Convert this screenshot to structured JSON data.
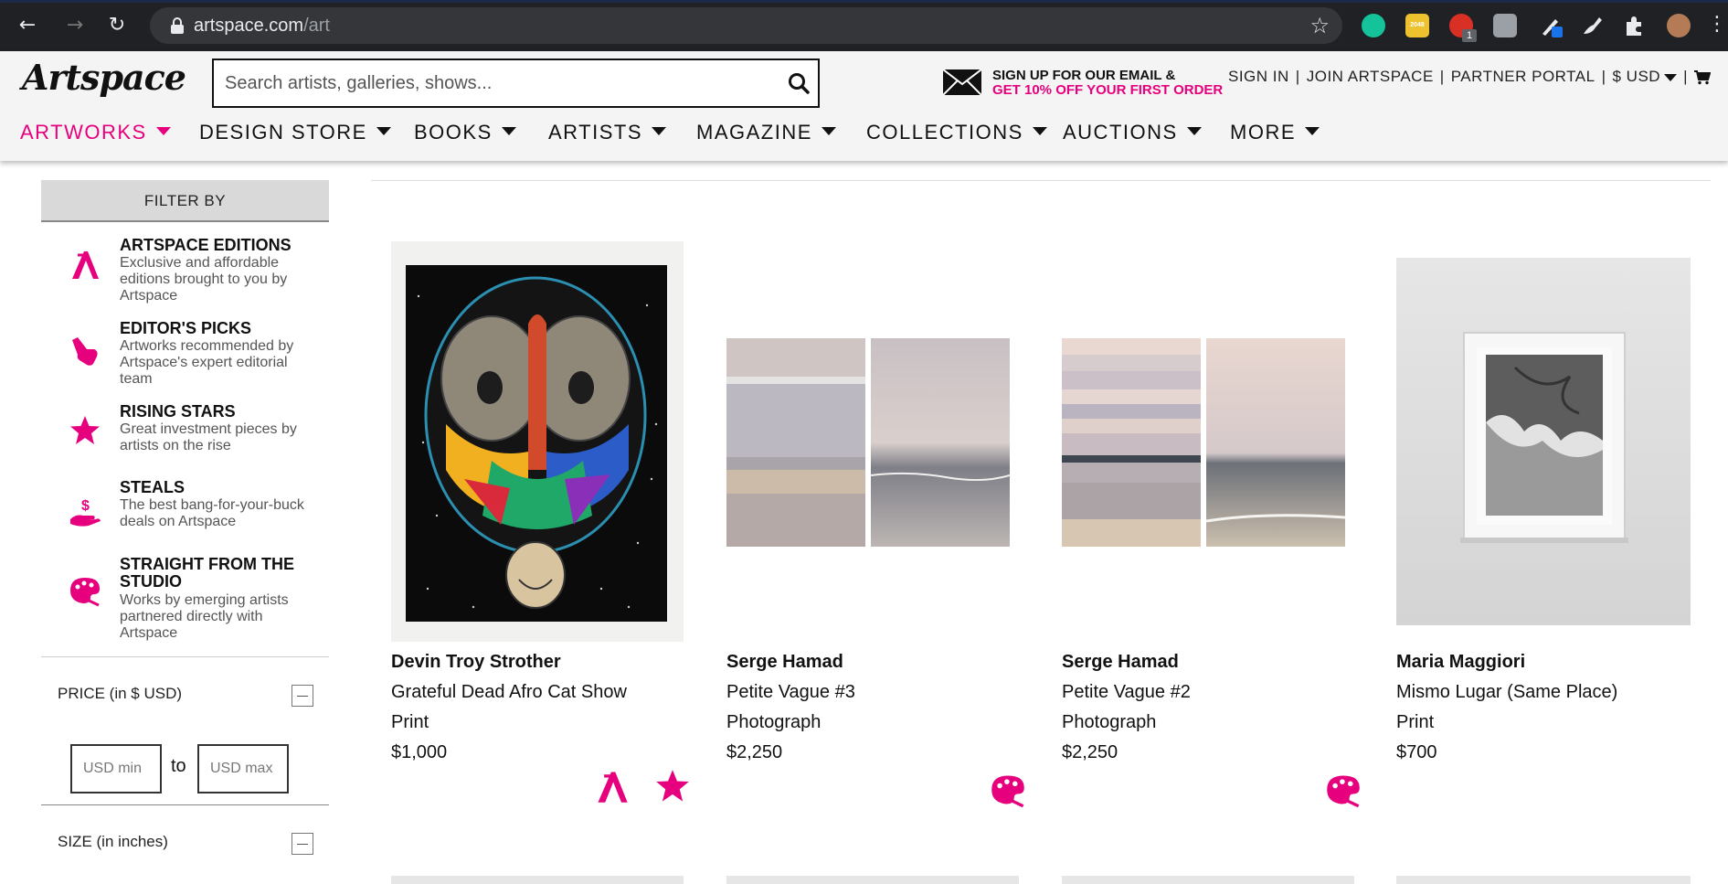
{
  "browser": {
    "url_host": "artspace.com",
    "url_path": "/art",
    "extension_badge": "1",
    "extension_2048": "2048"
  },
  "header": {
    "logo": "Artspace",
    "search_placeholder": "Search artists, galleries, shows...",
    "promo_line1": "SIGN UP FOR OUR EMAIL &",
    "promo_line2": "GET 10% OFF YOUR FIRST ORDER",
    "sign_in": "SIGN IN",
    "join": "JOIN ARTSPACE",
    "partner_portal": "PARTNER PORTAL",
    "currency": "$ USD",
    "separator": "|"
  },
  "nav": [
    {
      "label": "ARTWORKS",
      "active": true
    },
    {
      "label": "DESIGN STORE",
      "active": false
    },
    {
      "label": "BOOKS",
      "active": false
    },
    {
      "label": "ARTISTS",
      "active": false
    },
    {
      "label": "MAGAZINE",
      "active": false
    },
    {
      "label": "COLLECTIONS",
      "active": false
    },
    {
      "label": "AUCTIONS",
      "active": false
    },
    {
      "label": "MORE",
      "active": false
    }
  ],
  "sidebar": {
    "filter_by": "FILTER BY",
    "categories": [
      {
        "title": "ARTSPACE EDITIONS",
        "desc": "Exclusive and affordable editions brought to you by Artspace",
        "icon": "artspace-editions-icon"
      },
      {
        "title": "EDITOR'S PICKS",
        "desc": "Artworks recommended by Artspace's expert editorial team",
        "icon": "pointing-hand-icon"
      },
      {
        "title": "RISING STARS",
        "desc": "Great investment pieces by artists on the rise",
        "icon": "star-icon"
      },
      {
        "title": "STEALS",
        "desc": "The best bang-for-your-buck deals on Artspace",
        "icon": "hand-dollar-icon"
      },
      {
        "title": "STRAIGHT FROM THE STUDIO",
        "desc": "Works by emerging artists partnered directly with Artspace",
        "icon": "palette-icon"
      }
    ],
    "price_title": "PRICE (in $ USD)",
    "price_min_placeholder": "USD min",
    "price_to": "to",
    "price_max_placeholder": "USD max",
    "size_title": "SIZE (in inches)"
  },
  "products": [
    {
      "artist": "Devin Troy Strother",
      "title": "Grateful Dead Afro Cat Show",
      "medium": "Print",
      "price": "$1,000",
      "badges": [
        "artspace-editions-icon",
        "star-icon"
      ]
    },
    {
      "artist": "Serge Hamad",
      "title": "Petite Vague #3",
      "medium": "Photograph",
      "price": "$2,250",
      "badges": [
        "palette-icon"
      ]
    },
    {
      "artist": "Serge Hamad",
      "title": "Petite Vague #2",
      "medium": "Photograph",
      "price": "$2,250",
      "badges": [
        "palette-icon"
      ]
    },
    {
      "artist": "Maria Maggiori",
      "title": "Mismo Lugar (Same Place)",
      "medium": "Print",
      "price": "$700",
      "badges": []
    }
  ],
  "colors": {
    "accent": "#e6007e",
    "chrome": "#202124",
    "header_bg": "#f4f4f4"
  }
}
